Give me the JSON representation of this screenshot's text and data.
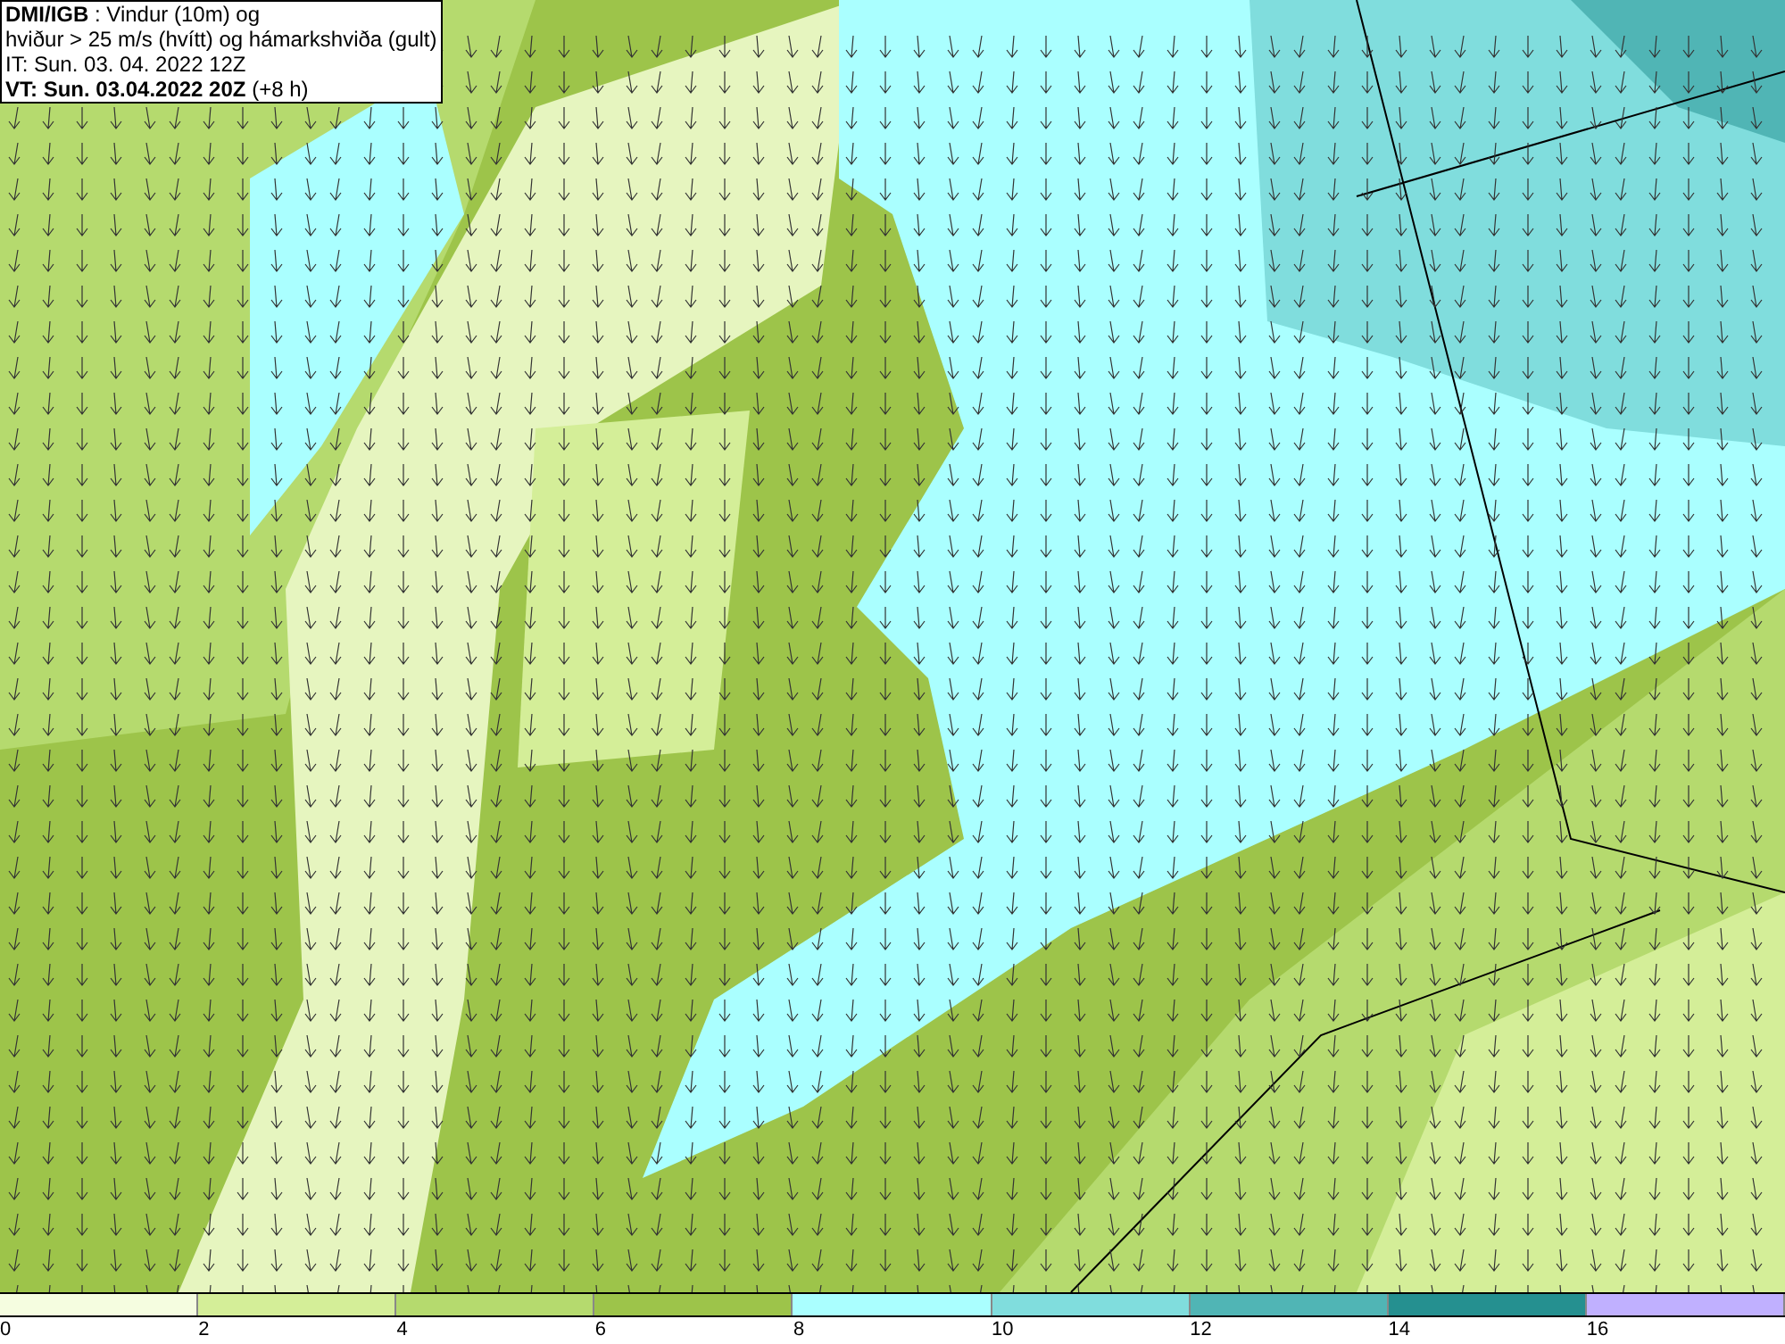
{
  "info_box": {
    "lines": [
      "**DMI/IGB** : Vindur (10m) og",
      "hviður > 25 m/s (hvítt) og hámarkshviða (gult)",
      "IT: Sun. 03. 04. 2022 12Z",
      "**VT: Sun. 03.04.2022 20Z** (+8 h)"
    ]
  },
  "legend": {
    "bins": [
      {
        "label": "0",
        "color": "#f5fde0"
      },
      {
        "label": "2",
        "color": "#d4ee98"
      },
      {
        "label": "4",
        "color": "#b5da6e"
      },
      {
        "label": "6",
        "color": "#9dc44a"
      },
      {
        "label": "8",
        "color": "#aaffff"
      },
      {
        "label": "10",
        "color": "#80dddd"
      },
      {
        "label": "12",
        "color": "#50b5b5"
      },
      {
        "label": "14",
        "color": "#259090"
      },
      {
        "label": "16",
        "color": "#c0b0ff"
      }
    ]
  }
}
